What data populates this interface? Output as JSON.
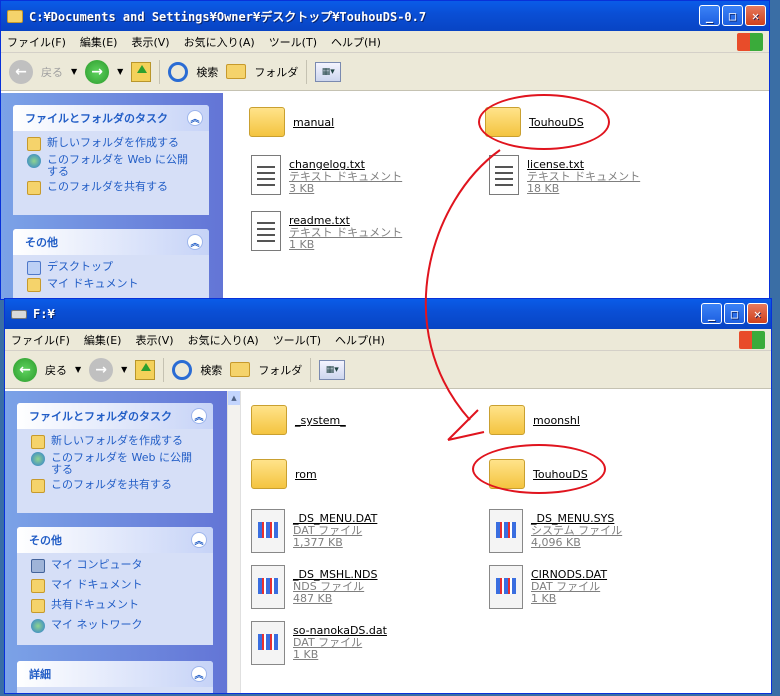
{
  "back_window": {
    "title": "C:¥Documents and Settings¥Owner¥デスクトップ¥TouhouDS-0.7",
    "menu": [
      "ファイル(F)",
      "編集(E)",
      "表示(V)",
      "お気に入り(A)",
      "ツール(T)",
      "ヘルプ(H)"
    ],
    "toolbar": {
      "back": "戻る",
      "search": "検索",
      "folders": "フォルダ"
    },
    "tasks_title": "ファイルとフォルダのタスク",
    "tasks": [
      "新しいフォルダを作成する",
      "このフォルダを Web に公開する",
      "このフォルダを共有する"
    ],
    "other_title": "その他",
    "other": [
      "デスクトップ",
      "マイ ドキュメント"
    ],
    "files": [
      {
        "name": "manual",
        "type": "folder"
      },
      {
        "name": "TouhouDS",
        "type": "folder"
      },
      {
        "name": "changelog.txt",
        "kind": "テキスト ドキュメント",
        "size": "3 KB"
      },
      {
        "name": "license.txt",
        "kind": "テキスト ドキュメント",
        "size": "18 KB"
      },
      {
        "name": "readme.txt",
        "kind": "テキスト ドキュメント",
        "size": "1 KB"
      }
    ]
  },
  "front_window": {
    "title": "F:¥",
    "menu": [
      "ファイル(F)",
      "編集(E)",
      "表示(V)",
      "お気に入り(A)",
      "ツール(T)",
      "ヘルプ(H)"
    ],
    "toolbar": {
      "back": "戻る",
      "search": "検索",
      "folders": "フォルダ"
    },
    "tasks_title": "ファイルとフォルダのタスク",
    "tasks": [
      "新しいフォルダを作成する",
      "このフォルダを Web に公開する",
      "このフォルダを共有する"
    ],
    "other_title": "その他",
    "other": [
      "マイ コンピュータ",
      "マイ ドキュメント",
      "共有ドキュメント",
      "マイ ネットワーク"
    ],
    "details_title": "詳細",
    "files": [
      {
        "name": "_system_",
        "type": "folder"
      },
      {
        "name": "moonshl",
        "type": "folder"
      },
      {
        "name": "rom",
        "type": "folder"
      },
      {
        "name": "TouhouDS",
        "type": "folder"
      },
      {
        "name": "_DS_MENU.DAT",
        "kind": "DAT ファイル",
        "size": "1,377 KB"
      },
      {
        "name": "_DS_MENU.SYS",
        "kind": "システム ファイル",
        "size": "4,096 KB"
      },
      {
        "name": "_DS_MSHL.NDS",
        "kind": "NDS ファイル",
        "size": "487 KB"
      },
      {
        "name": "CIRNODS.DAT",
        "kind": "DAT ファイル",
        "size": "1 KB"
      },
      {
        "name": "so-nanokaDS.dat",
        "kind": "DAT ファイル",
        "size": "1 KB"
      }
    ]
  },
  "colors": {
    "titlebar": "#0a4fd6",
    "taskpane": "#6f8ce0",
    "annotation": "#e0141e"
  },
  "icons": [
    "folder-icon",
    "text-document-icon",
    "dat-file-icon",
    "back-icon",
    "forward-icon",
    "up-icon",
    "search-icon",
    "folders-icon",
    "views-icon"
  ]
}
